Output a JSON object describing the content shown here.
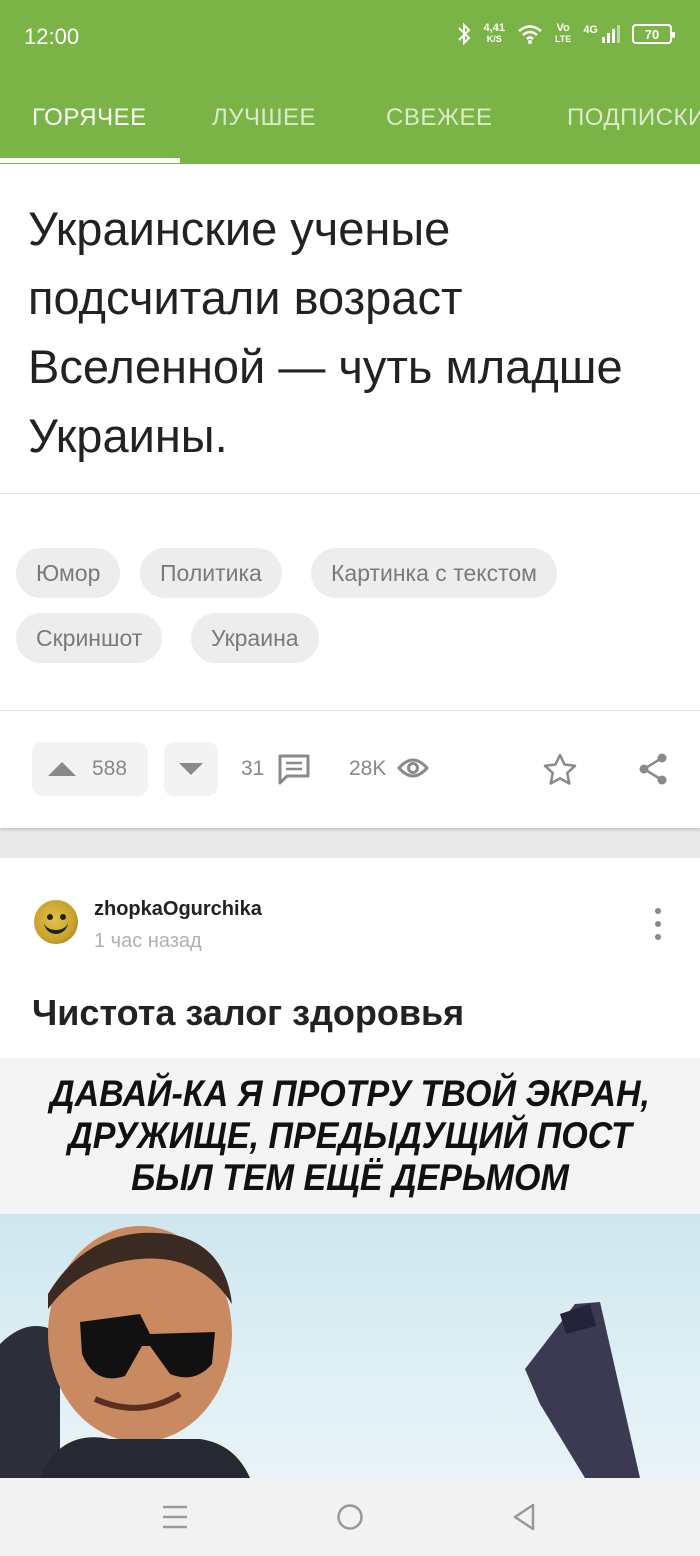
{
  "status_bar": {
    "time": "12:00",
    "speed_value": "4,41",
    "speed_unit": "K/S",
    "volte_top": "Vo",
    "volte_bottom": "LTE",
    "network": "4G",
    "battery": "70"
  },
  "tabs": [
    {
      "label": "ГОРЯЧЕЕ",
      "active": true
    },
    {
      "label": "ЛУЧШЕЕ",
      "active": false
    },
    {
      "label": "СВЕЖЕЕ",
      "active": false
    },
    {
      "label": "ПОДПИСКИ",
      "active": false
    }
  ],
  "post1": {
    "headline": "Украинские ученые подсчитали возраст Вселенной — чуть младше Украины.",
    "tags": [
      "Юмор",
      "Политика",
      "Картинка с текстом",
      "Скриншот",
      "Украина"
    ],
    "rating": "588",
    "comments": "31",
    "views": "28K"
  },
  "post2": {
    "author": "zhopkaOgurchika",
    "time_ago": "1 час назад",
    "title": "Чистота залог здоровья",
    "meme_caption": "ДАВАЙ-КА Я ПРОТРУ ТВОЙ ЭКРАН, ДРУЖИЩЕ, ПРЕДЫДУЩИЙ ПОСТ БЫЛ ТЕМ ЕЩЁ ДЕРЬМОМ"
  },
  "colors": {
    "brand_green": "#7ab446",
    "icon_gray": "#8a8a8a"
  },
  "icons": {
    "status": [
      "bluetooth-icon",
      "wifi-icon",
      "signal-icon",
      "battery-icon"
    ],
    "post_actions": [
      "upvote-icon",
      "downvote-icon",
      "comment-icon",
      "eye-icon",
      "star-icon",
      "share-icon"
    ],
    "nav": [
      "menu-icon",
      "home-icon",
      "back-icon"
    ]
  }
}
